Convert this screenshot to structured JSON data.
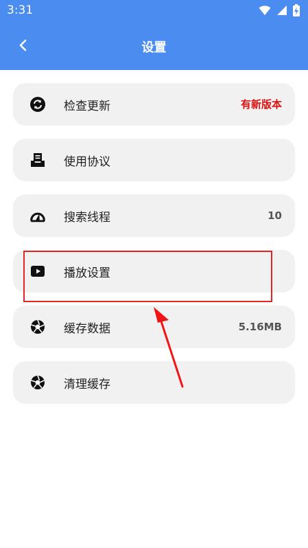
{
  "status": {
    "time": "3:31"
  },
  "header": {
    "title": "设置"
  },
  "settings": {
    "items": [
      {
        "label": "检查更新",
        "value": "有新版本",
        "icon": "sync-icon"
      },
      {
        "label": "使用协议",
        "value": "",
        "icon": "document-tray-icon"
      },
      {
        "label": "搜索线程",
        "value": "10",
        "icon": "speedometer-icon"
      },
      {
        "label": "播放设置",
        "value": "",
        "icon": "play-icon"
      },
      {
        "label": "缓存数据",
        "value": "5.16MB",
        "icon": "aperture-icon"
      },
      {
        "label": "清理缓存",
        "value": "",
        "icon": "aperture-icon"
      }
    ]
  },
  "colors": {
    "header": "#4a8cf0",
    "card": "#f1f1f1",
    "alert": "#e01010",
    "annotation": "#e62222"
  }
}
